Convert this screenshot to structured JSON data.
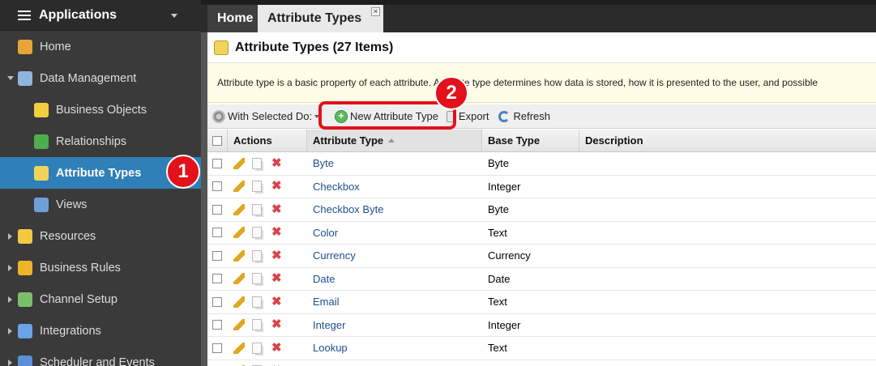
{
  "sidebar": {
    "title": "Applications",
    "items": [
      {
        "label": "Home",
        "icon": "home-icon",
        "level": 1,
        "active": false,
        "arrow": "none"
      },
      {
        "label": "Data Management",
        "icon": "database-icon",
        "level": 1,
        "active": false,
        "arrow": "down"
      },
      {
        "label": "Business Objects",
        "icon": "cylinder-icon",
        "level": 2,
        "active": false,
        "arrow": "none"
      },
      {
        "label": "Relationships",
        "icon": "shuffle-icon",
        "level": 2,
        "active": false,
        "arrow": "none"
      },
      {
        "label": "Attribute Types",
        "icon": "attribute-type-icon",
        "level": 2,
        "active": true,
        "arrow": "none"
      },
      {
        "label": "Views",
        "icon": "table-icon",
        "level": 2,
        "active": false,
        "arrow": "none"
      },
      {
        "label": "Resources",
        "icon": "lightbulb-icon",
        "level": 1,
        "active": false,
        "arrow": "right"
      },
      {
        "label": "Business Rules",
        "icon": "lightning-icon",
        "level": 1,
        "active": false,
        "arrow": "right"
      },
      {
        "label": "Channel Setup",
        "icon": "basket-icon",
        "level": 1,
        "active": false,
        "arrow": "right"
      },
      {
        "label": "Integrations",
        "icon": "phone-icon",
        "level": 1,
        "active": false,
        "arrow": "right"
      },
      {
        "label": "Scheduler and Events",
        "icon": "clock-icon",
        "level": 1,
        "active": false,
        "arrow": "right"
      }
    ]
  },
  "tabs": [
    {
      "label": "Home"
    },
    {
      "label": "Attribute Types",
      "close": "×"
    }
  ],
  "page": {
    "title": "Attribute Types (27 Items)",
    "notice": "Attribute type is a basic property of each attribute. Attribute type determines how data is stored, how it is presented to the user, and possible"
  },
  "toolbar": {
    "with_selected": "With Selected Do:",
    "new_button": "New Attribute Type",
    "export": "Export",
    "refresh": "Refresh"
  },
  "annotations": {
    "badge1": "1",
    "badge2": "2"
  },
  "table": {
    "headers": {
      "actions": "Actions",
      "attribute_type": "Attribute Type",
      "base_type": "Base Type",
      "description": "Description"
    },
    "rows": [
      {
        "name": "Byte",
        "base": "Byte"
      },
      {
        "name": "Checkbox",
        "base": "Integer"
      },
      {
        "name": "Checkbox Byte",
        "base": "Byte"
      },
      {
        "name": "Color",
        "base": "Text"
      },
      {
        "name": "Currency",
        "base": "Currency"
      },
      {
        "name": "Date",
        "base": "Date"
      },
      {
        "name": "Email",
        "base": "Text"
      },
      {
        "name": "Integer",
        "base": "Integer"
      },
      {
        "name": "Lookup",
        "base": "Text"
      },
      {
        "name": "",
        "base": ""
      }
    ]
  },
  "colors": {
    "active": "#2f7fb8",
    "link": "#1f4e8c",
    "highlight": "#e3111b",
    "notice_bg": "#fffde6"
  }
}
